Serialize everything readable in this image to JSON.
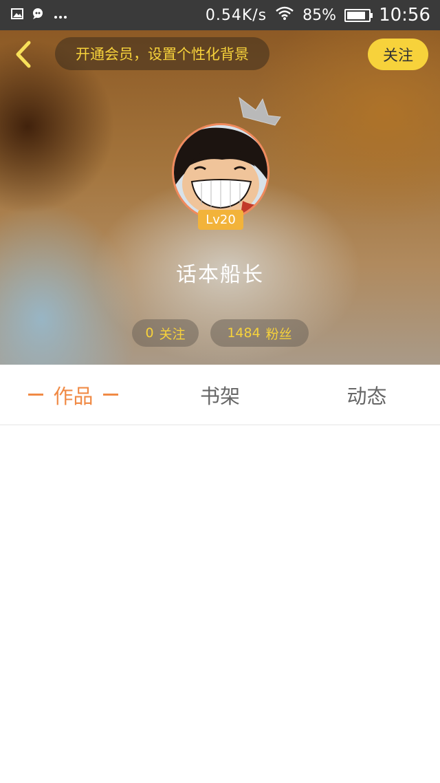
{
  "status_bar": {
    "left_icons": [
      "image-icon",
      "chat-icon",
      "more-dots-icon"
    ],
    "net_speed": "0.54K/s",
    "battery_percent": "85%",
    "battery_level": 0.85,
    "time": "10:56"
  },
  "header": {
    "vip_prompt": "开通会员，设置个性化背景",
    "follow_label": "关注",
    "back_icon": "back-chevron-icon",
    "accent_color": "#f7d23b"
  },
  "profile": {
    "level": "Lv20",
    "username": "话本船长",
    "following_count": "0",
    "following_label": "关注",
    "fans_count": "1484",
    "fans_label": "粉丝"
  },
  "tabs": [
    {
      "label": "作品",
      "active": true
    },
    {
      "label": "书架",
      "active": false
    },
    {
      "label": "动态",
      "active": false
    }
  ],
  "colors": {
    "active_tab": "#f08a45",
    "inactive_tab": "#666666",
    "level_badge": "#f2b33a",
    "avatar_border": "#f08a5d"
  }
}
